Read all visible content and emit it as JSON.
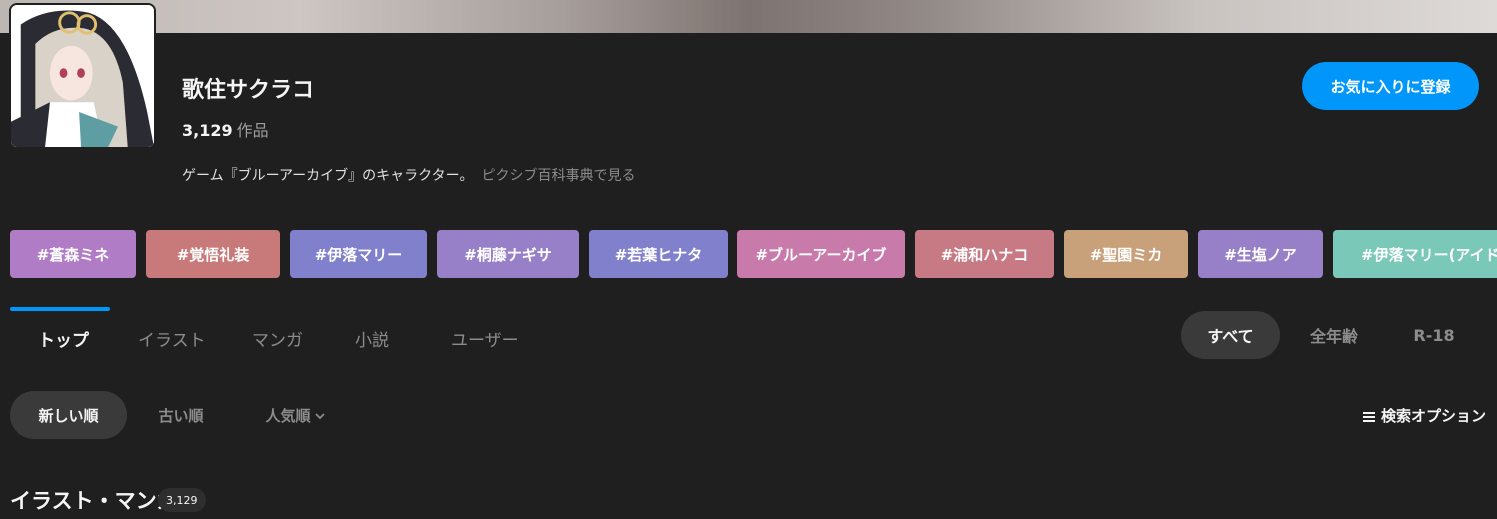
{
  "header": {
    "tag_name": "歌住サクラコ",
    "work_count": "3,129",
    "work_unit": "作品",
    "description": "ゲーム『ブルーアーカイブ』のキャラクター。",
    "dictionary_link": "ピクシブ百科事典で見る",
    "favorite_label": "お気に入りに登録"
  },
  "related_tags": [
    {
      "label": "#蒼森ミネ",
      "color": "#b07cc6"
    },
    {
      "label": "#覚悟礼装",
      "color": "#c87a7a"
    },
    {
      "label": "#伊落マリー",
      "color": "#8080cc"
    },
    {
      "label": "#桐藤ナギサ",
      "color": "#9880c8"
    },
    {
      "label": "#若葉ヒナタ",
      "color": "#8080cc"
    },
    {
      "label": "#ブルーアーカイブ",
      "color": "#c87aab"
    },
    {
      "label": "#浦和ハナコ",
      "color": "#c87a84"
    },
    {
      "label": "#聖園ミカ",
      "color": "#c8a07a"
    },
    {
      "label": "#生塩ノア",
      "color": "#9880c8"
    },
    {
      "label": "#伊落マリー(アイドル)",
      "color": "#7ac8b8"
    }
  ],
  "tabs": [
    {
      "label": "トップ",
      "active": true
    },
    {
      "label": "イラスト",
      "active": false
    },
    {
      "label": "マンガ",
      "active": false
    },
    {
      "label": "小説",
      "active": false
    },
    {
      "label": "ユーザー",
      "active": false
    }
  ],
  "age_filter": [
    {
      "label": "すべて",
      "active": true
    },
    {
      "label": "全年齢",
      "active": false
    },
    {
      "label": "R-18",
      "active": false
    }
  ],
  "sort": [
    {
      "label": "新しい順",
      "active": true
    },
    {
      "label": "古い順",
      "active": false
    },
    {
      "label": "人気順",
      "active": false
    }
  ],
  "search_options_label": "検索オプション",
  "section": {
    "title": "イラスト・マンガ",
    "count": "3,129"
  },
  "colors": {
    "accent": "#0096fa",
    "background": "#1f1f1f"
  }
}
